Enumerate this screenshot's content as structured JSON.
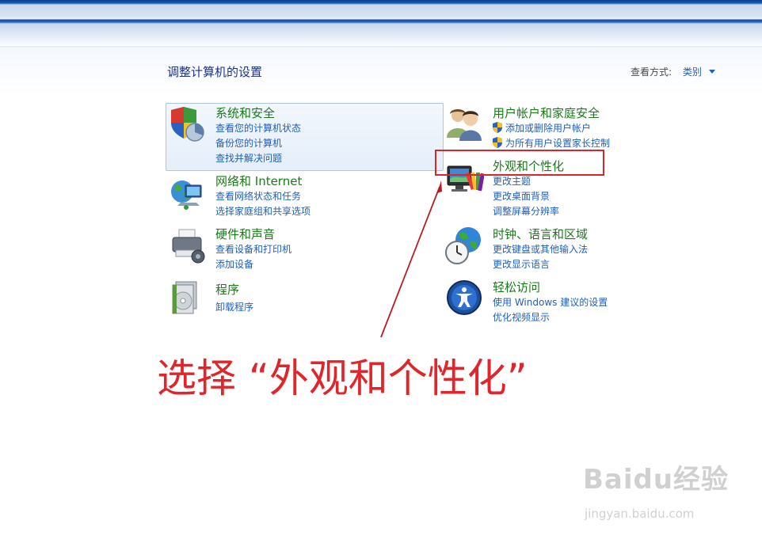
{
  "header": {
    "title": "调整计算机的设置",
    "view_by_label": "查看方式:",
    "view_by_value": "类别"
  },
  "categories": [
    {
      "title": "系统和安全",
      "icon": "shield-icon",
      "links": [
        "查看您的计算机状态",
        "备份您的计算机",
        "查找并解决问题"
      ]
    },
    {
      "title": "网络和 Internet",
      "icon": "network-globe-icon",
      "links": [
        "查看网络状态和任务",
        "选择家庭组和共享选项"
      ]
    },
    {
      "title": "硬件和声音",
      "icon": "printer-icon",
      "links": [
        "查看设备和打印机",
        "添加设备"
      ]
    },
    {
      "title": "程序",
      "icon": "programs-icon",
      "links": [
        "卸载程序"
      ]
    },
    {
      "title": "用户帐户和家庭安全",
      "icon": "users-icon",
      "links": [
        "添加或删除用户帐户",
        "为所有用户设置家长控制"
      ]
    },
    {
      "title": "外观和个性化",
      "icon": "monitor-palette-icon",
      "links": [
        "更改主题",
        "更改桌面背景",
        "调整屏幕分辨率"
      ]
    },
    {
      "title": "时钟、语言和区域",
      "icon": "globe-clock-icon",
      "links": [
        "更改键盘或其他输入法",
        "更改显示语言"
      ]
    },
    {
      "title": "轻松访问",
      "icon": "ease-of-access-icon",
      "links": [
        "使用 Windows 建议的设置",
        "优化视频显示"
      ]
    }
  ],
  "annotation": {
    "text": "选择 “外观和个性化”",
    "color": "#e0262b"
  },
  "watermark": {
    "logo": "Baidu经验",
    "url": "jingyan.baidu.com"
  },
  "colors": {
    "title_green": "#1a7a1a",
    "link_blue": "#1e5fbf",
    "header_blue": "#1e3287",
    "highlight_red": "#d9262b"
  }
}
